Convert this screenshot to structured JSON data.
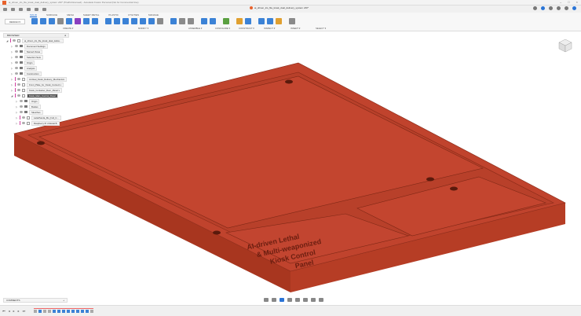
{
  "window": {
    "title": "ai_driven_lcs_file_kiosk_dual_delivery_system v60* (Trial/Unlicensed) - Autodesk Fusion Personal (Not for Commercial Use)",
    "controls": [
      "–",
      "□",
      "×"
    ]
  },
  "document_tab": {
    "name": "ai_driven_lcs_file_kiosk_dual_delivery_system v60*"
  },
  "ribbon": {
    "workspace": "DESIGN ▾",
    "tabs": [
      "SOLID",
      "SURFACE",
      "MESH",
      "SHEET METAL",
      "PLASTIC",
      "UTILITIES",
      "MANAGE"
    ],
    "active_tab": "SOLID",
    "groups": [
      "CREATE ▾",
      "MODIFY ▾",
      "ASSEMBLE ▾",
      "CONFIGURE ▾",
      "CONSTRUCT ▾",
      "INSPECT ▾",
      "INSERT ▾",
      "SELECT ▾"
    ]
  },
  "browser": {
    "title": "BROWSER",
    "items": [
      {
        "label": "ai_driven_lcs_file_kiosk_dual_delive...",
        "depth": 0,
        "kind": "root"
      },
      {
        "label": "Document Settings",
        "depth": 1,
        "kind": "folder"
      },
      {
        "label": "Named Views",
        "depth": 1,
        "kind": "folder"
      },
      {
        "label": "Selection Sets",
        "depth": 1,
        "kind": "folder"
      },
      {
        "label": "Origin",
        "depth": 1,
        "kind": "folder"
      },
      {
        "label": "Analysis",
        "depth": 1,
        "kind": "folder"
      },
      {
        "label": "Construction",
        "depth": 1,
        "kind": "folder"
      },
      {
        "label": "AI-Dual_Kiosk_Delivery_Mechanism",
        "depth": 1,
        "kind": "component"
      },
      {
        "label": "Front_Plate_for_Kiosk_Content v",
        "depth": 1,
        "kind": "component"
      },
      {
        "label": "Kiosk_Container_Door_Panel v",
        "depth": 1,
        "kind": "component"
      },
      {
        "label": "Kiosk_Main_Control_Panel",
        "depth": 1,
        "kind": "component",
        "selected": true
      },
      {
        "label": "Origin",
        "depth": 2,
        "kind": "folder"
      },
      {
        "label": "Bodies",
        "depth": 2,
        "kind": "folder"
      },
      {
        "label": "Sketches",
        "depth": 2,
        "kind": "folder"
      },
      {
        "label": "LattePanda_Mu_Full_C...",
        "depth": 2,
        "kind": "component"
      },
      {
        "label": "Raspberry Pi 4 Model B",
        "depth": 2,
        "kind": "component"
      }
    ]
  },
  "model": {
    "engraved_text": "AI-driven Lethal & Multi-weaponized Kiosk Control Panel",
    "color": "#c0432d"
  },
  "comments": {
    "label": "COMMENTS"
  },
  "colors": {
    "accent": "#1a6ad1",
    "model": "#c0432d"
  }
}
